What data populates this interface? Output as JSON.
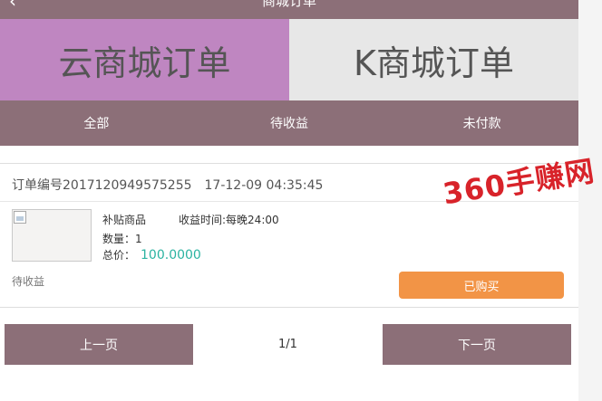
{
  "header": {
    "back_icon": "‹",
    "title": "商城订单"
  },
  "shop_tabs": [
    {
      "label": "云商城订单",
      "active": true
    },
    {
      "label": "K商城订单",
      "active": false
    }
  ],
  "status_tabs": [
    {
      "label": "全部"
    },
    {
      "label": "待收益"
    },
    {
      "label": "未付款"
    }
  ],
  "order": {
    "number_label": "订单编号2017120949575255",
    "timestamp": "17-12-09 04:35:45",
    "product_name": "补贴商品",
    "profit_time": "收益时间:每晚24:00",
    "quantity": "数量：1",
    "total_label": "总价：",
    "total_amount": "100.0000",
    "status": "待收益",
    "action_label": "已购买"
  },
  "pager": {
    "prev": "上一页",
    "page_info": "1/1",
    "next": "下一页"
  },
  "watermark": {
    "text": "360手赚网"
  },
  "colors": {
    "primary": "#8c6f78",
    "active_tab": "#bf86c1",
    "inactive_tab": "#e7e7e7",
    "accent_button": "#f29446",
    "price": "#2bb3a1",
    "watermark": "#d8232a"
  }
}
